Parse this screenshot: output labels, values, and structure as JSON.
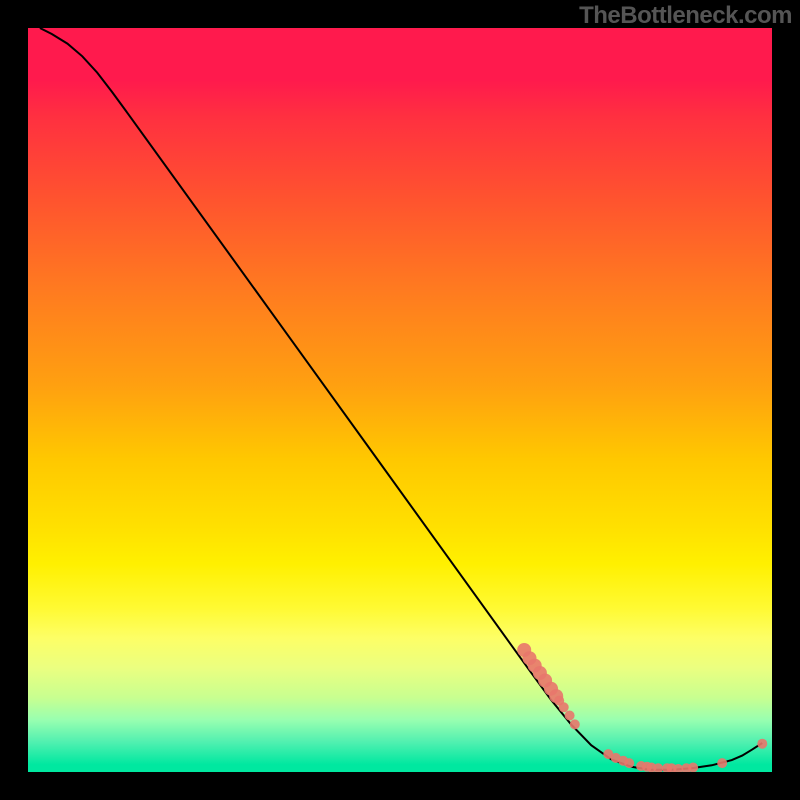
{
  "brand": "TheBottleneck.com",
  "chart_data": {
    "type": "line",
    "title": "",
    "xlabel": "",
    "ylabel": "",
    "xlim": [
      0,
      100
    ],
    "ylim": [
      0,
      100
    ],
    "axes_shown": false,
    "curve": [
      {
        "x": 1.6,
        "y": 100.0
      },
      {
        "x": 3.2,
        "y": 99.2
      },
      {
        "x": 5.3,
        "y": 97.9
      },
      {
        "x": 7.3,
        "y": 96.2
      },
      {
        "x": 9.3,
        "y": 94.0
      },
      {
        "x": 11.3,
        "y": 91.4
      },
      {
        "x": 13.5,
        "y": 88.4
      },
      {
        "x": 33.5,
        "y": 60.7
      },
      {
        "x": 67.6,
        "y": 13.4
      },
      {
        "x": 70.3,
        "y": 9.7
      },
      {
        "x": 73.0,
        "y": 6.4
      },
      {
        "x": 75.7,
        "y": 3.6
      },
      {
        "x": 78.4,
        "y": 1.7
      },
      {
        "x": 81.1,
        "y": 0.7
      },
      {
        "x": 83.8,
        "y": 0.3
      },
      {
        "x": 86.5,
        "y": 0.3
      },
      {
        "x": 89.2,
        "y": 0.5
      },
      {
        "x": 91.9,
        "y": 0.9
      },
      {
        "x": 94.6,
        "y": 1.6
      },
      {
        "x": 96.0,
        "y": 2.2
      },
      {
        "x": 97.3,
        "y": 3.0
      },
      {
        "x": 98.7,
        "y": 3.9
      }
    ],
    "markers": [
      {
        "x": 66.7,
        "y": 16.4,
        "r": 7
      },
      {
        "x": 67.4,
        "y": 15.3,
        "r": 7
      },
      {
        "x": 68.1,
        "y": 14.3,
        "r": 7
      },
      {
        "x": 68.8,
        "y": 13.3,
        "r": 7
      },
      {
        "x": 69.5,
        "y": 12.3,
        "r": 7
      },
      {
        "x": 70.3,
        "y": 11.2,
        "r": 7
      },
      {
        "x": 71.0,
        "y": 10.2,
        "r": 7
      },
      {
        "x": 71.4,
        "y": 9.6,
        "r": 5
      },
      {
        "x": 72.0,
        "y": 8.7,
        "r": 5
      },
      {
        "x": 72.8,
        "y": 7.6,
        "r": 5
      },
      {
        "x": 73.5,
        "y": 6.4,
        "r": 5
      },
      {
        "x": 78.0,
        "y": 2.4,
        "r": 5
      },
      {
        "x": 79.0,
        "y": 1.9,
        "r": 5
      },
      {
        "x": 80.0,
        "y": 1.5,
        "r": 5
      },
      {
        "x": 80.8,
        "y": 1.2,
        "r": 5
      },
      {
        "x": 82.4,
        "y": 0.8,
        "r": 5
      },
      {
        "x": 83.2,
        "y": 0.7,
        "r": 5
      },
      {
        "x": 83.8,
        "y": 0.6,
        "r": 5
      },
      {
        "x": 84.7,
        "y": 0.5,
        "r": 5
      },
      {
        "x": 85.9,
        "y": 0.5,
        "r": 5
      },
      {
        "x": 86.5,
        "y": 0.5,
        "r": 5
      },
      {
        "x": 87.4,
        "y": 0.4,
        "r": 5
      },
      {
        "x": 88.5,
        "y": 0.5,
        "r": 5
      },
      {
        "x": 89.4,
        "y": 0.6,
        "r": 5
      },
      {
        "x": 93.3,
        "y": 1.2,
        "r": 5
      },
      {
        "x": 98.7,
        "y": 3.8,
        "r": 5
      }
    ]
  }
}
